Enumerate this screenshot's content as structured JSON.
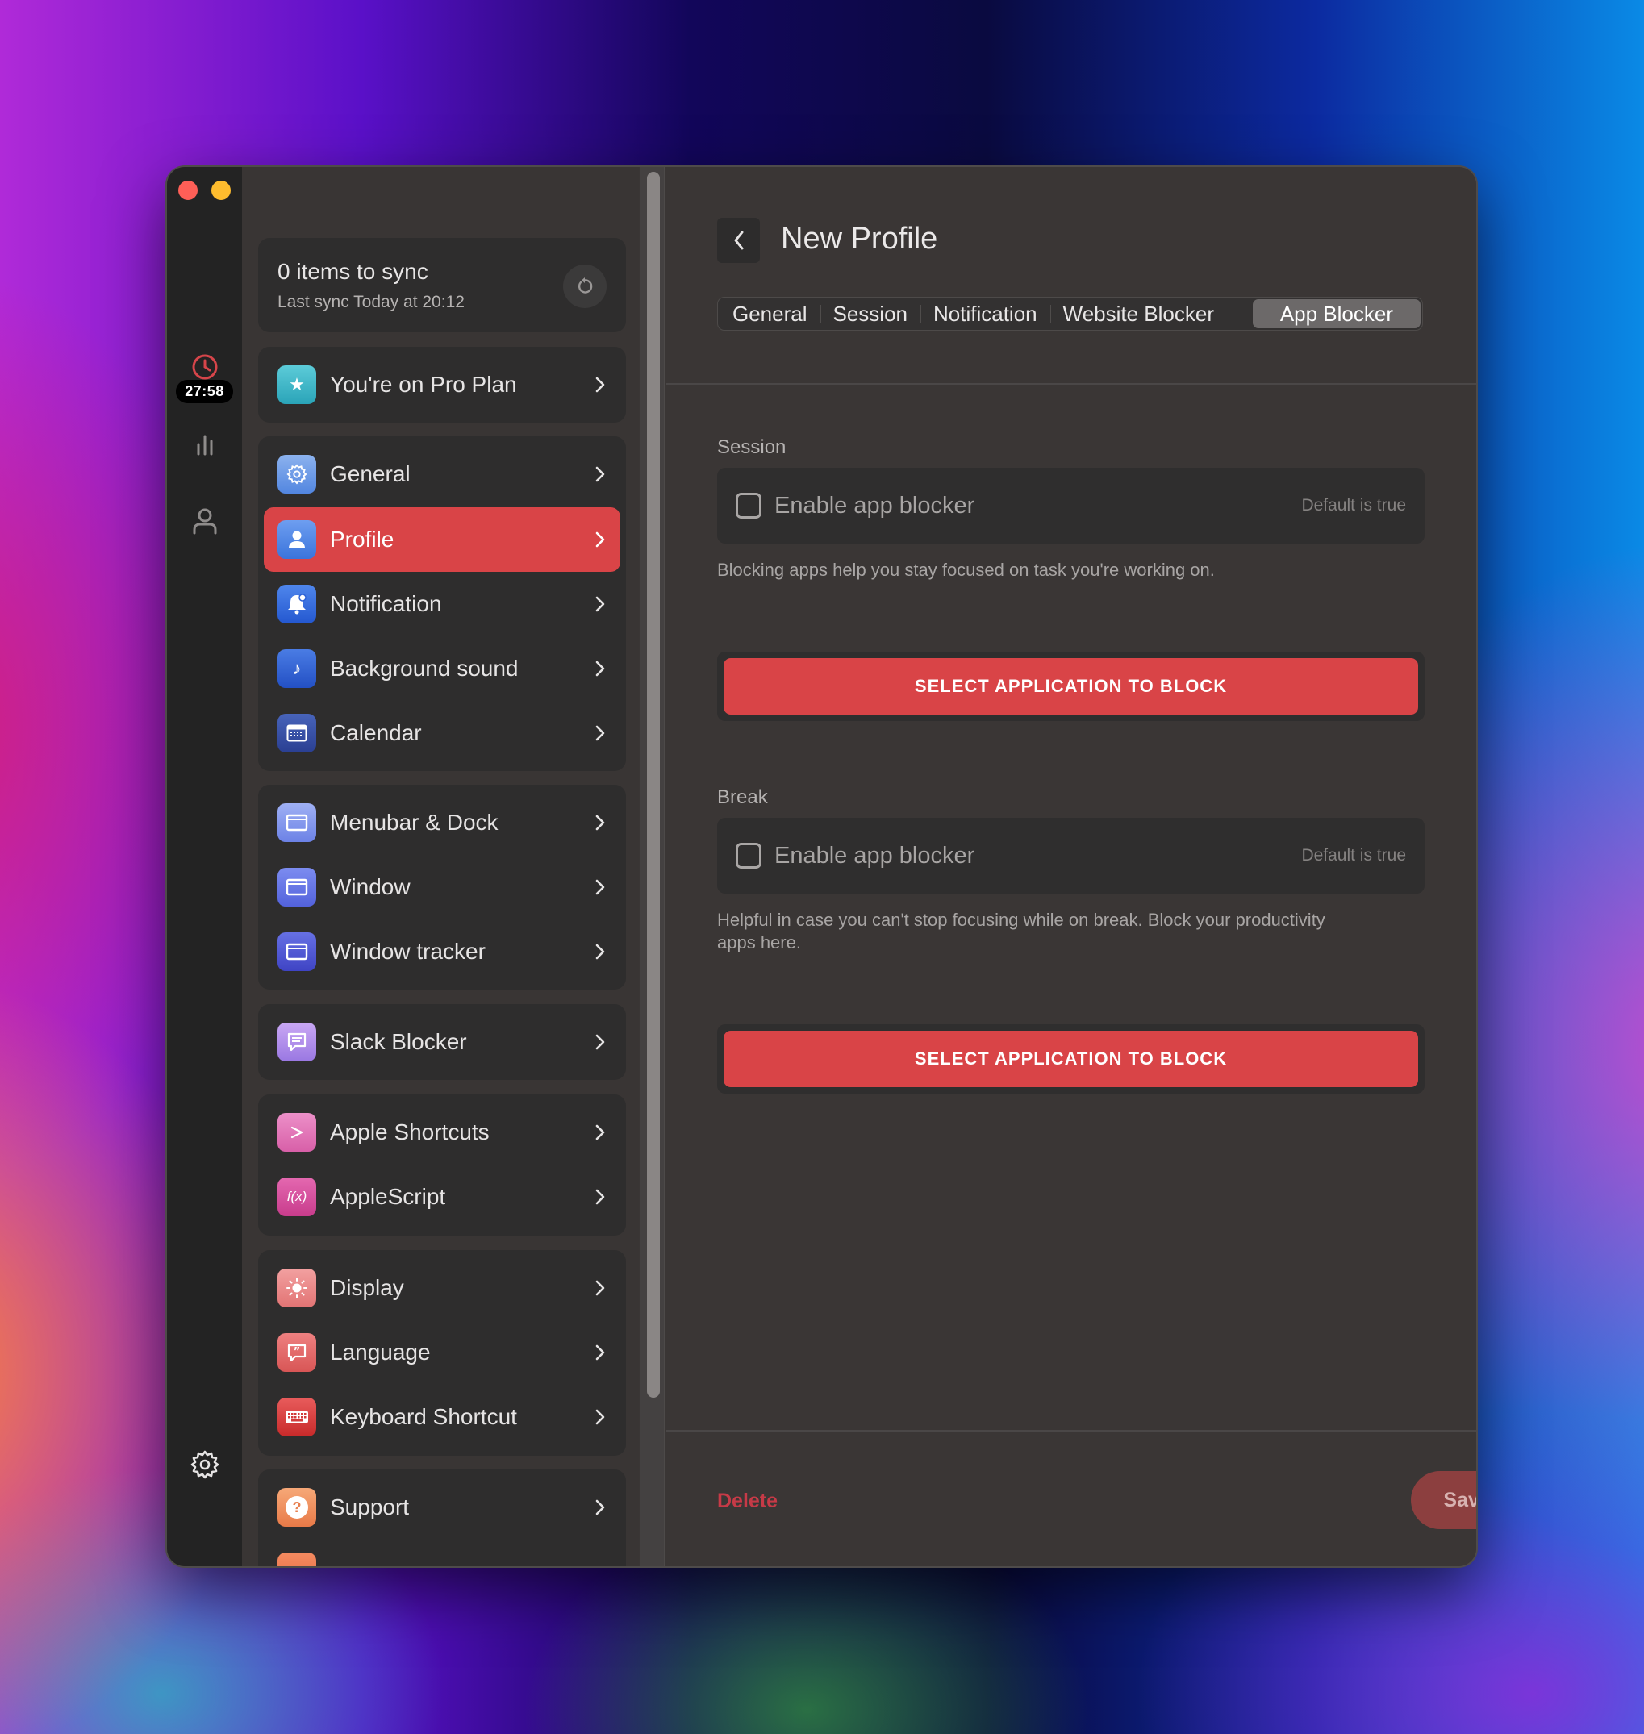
{
  "window": {
    "traffic_lights": [
      "close",
      "minimize",
      "maximize"
    ]
  },
  "rail": {
    "timer": "27:58",
    "icons": [
      "clock-icon",
      "stats-icon",
      "user-icon",
      "settings-icon"
    ]
  },
  "sidebar": {
    "sync": {
      "title": "0 items to sync",
      "subtitle": "Last sync Today at 20:12"
    },
    "pro_plan": {
      "label": "You're on Pro Plan",
      "icon": "star-icon"
    },
    "groups": [
      {
        "items": [
          {
            "label": "General",
            "icon": "gear-icon"
          },
          {
            "label": "Profile",
            "icon": "person-icon",
            "active": true
          },
          {
            "label": "Notification",
            "icon": "bell-icon"
          },
          {
            "label": "Background sound",
            "icon": "music-note-icon"
          },
          {
            "label": "Calendar",
            "icon": "calendar-icon"
          }
        ]
      },
      {
        "items": [
          {
            "label": "Menubar & Dock",
            "icon": "window-icon"
          },
          {
            "label": "Window",
            "icon": "window-icon"
          },
          {
            "label": "Window tracker",
            "icon": "window-icon"
          }
        ]
      },
      {
        "items": [
          {
            "label": "Slack Blocker",
            "icon": "chat-bubble-icon"
          }
        ]
      },
      {
        "items": [
          {
            "label": "Apple Shortcuts",
            "icon": "chevron-prompt-icon"
          },
          {
            "label": "AppleScript",
            "icon": "function-icon",
            "glyph": "f(x)"
          }
        ]
      },
      {
        "items": [
          {
            "label": "Display",
            "icon": "sun-icon"
          },
          {
            "label": "Language",
            "icon": "quote-bubble-icon"
          },
          {
            "label": "Keyboard Shortcut",
            "icon": "keyboard-icon"
          }
        ]
      },
      {
        "items": [
          {
            "label": "Support",
            "icon": "question-icon",
            "glyph": "?"
          }
        ]
      }
    ]
  },
  "main": {
    "title": "New Profile",
    "tabs": [
      {
        "label": "General"
      },
      {
        "label": "Session"
      },
      {
        "label": "Notification"
      },
      {
        "label": "Website Blocker"
      },
      {
        "label": "App Blocker",
        "selected": true
      }
    ],
    "sections": [
      {
        "label": "Session",
        "option_label": "Enable app blocker",
        "option_checked": false,
        "option_hint": "Default is true",
        "help": "Blocking apps help you stay focused on task you're working on.",
        "button": "SELECT APPLICATION TO BLOCK"
      },
      {
        "label": "Break",
        "option_label": "Enable app blocker",
        "option_checked": false,
        "option_hint": "Default is true",
        "help": "Helpful in case you can't stop focusing while on break. Block your productivity apps here.",
        "button": "SELECT APPLICATION TO BLOCK"
      }
    ],
    "footer": {
      "delete": "Delete",
      "save": "Save Profile"
    }
  },
  "colors": {
    "accent_red": "#d94447",
    "delete_red": "#c63a47",
    "save_button": "#8c3f3f"
  }
}
